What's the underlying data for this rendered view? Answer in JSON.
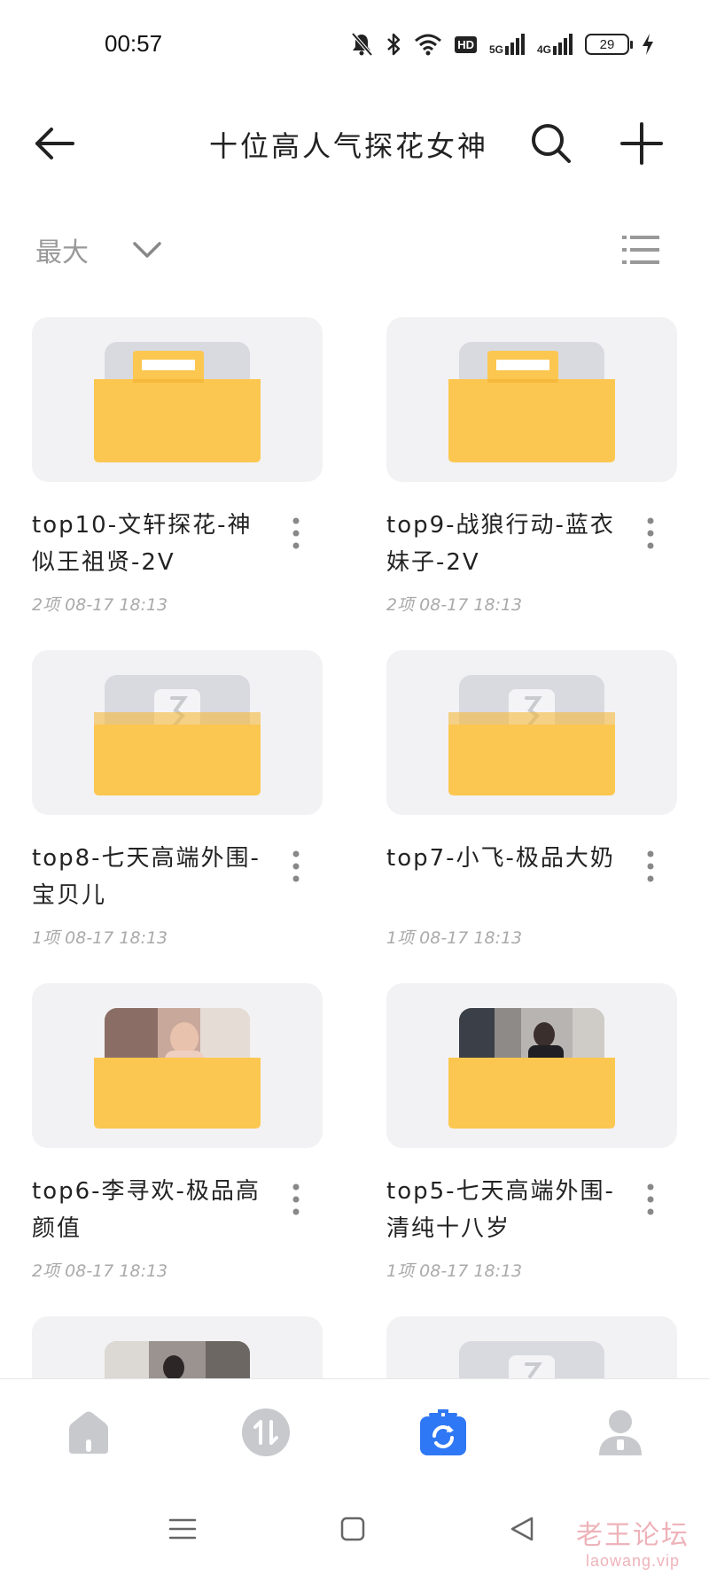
{
  "status_bar": {
    "time": "00:57",
    "icons": [
      "mute-icon",
      "bluetooth-icon",
      "wifi-icon",
      "hd-icon",
      "signal-5g-icon",
      "signal-4g-icon"
    ],
    "hd_label": "HD",
    "net1_label": "5G",
    "net2_label": "4G",
    "battery": "29"
  },
  "header": {
    "title": "十位高人气探花女神",
    "back_icon": "arrow-left-icon",
    "search_icon": "search-icon",
    "add_icon": "plus-icon"
  },
  "sort": {
    "label": "最大",
    "chevron_icon": "chevron-down-icon",
    "view_icon": "list-view-icon"
  },
  "folders": [
    {
      "title": "top10-文轩探花-神似王祖贤-2V",
      "count": "2项",
      "date": "08-17 18:13",
      "thumb": "empty-folder"
    },
    {
      "title": "top9-战狼行动-蓝衣妹子-2V",
      "count": "2项",
      "date": "08-17 18:13",
      "thumb": "empty-folder"
    },
    {
      "title": "top8-七天高端外围-宝贝儿",
      "count": "1项",
      "date": "08-17 18:13",
      "thumb": "app-folder"
    },
    {
      "title": "top7-小飞-极品大奶",
      "count": "1项",
      "date": "08-17 18:13",
      "thumb": "app-folder"
    },
    {
      "title": "top6-李寻欢-极品高颜值",
      "count": "2项",
      "date": "08-17 18:13",
      "thumb": "photo-folder"
    },
    {
      "title": "top5-七天高端外围-清纯十八岁",
      "count": "1项",
      "date": "08-17 18:13",
      "thumb": "photo-folder"
    }
  ],
  "bottom_nav": [
    {
      "name": "home",
      "icon": "home-icon",
      "active": false
    },
    {
      "name": "transfer",
      "icon": "transfer-icon",
      "active": false
    },
    {
      "name": "files",
      "icon": "cloud-files-icon",
      "active": true
    },
    {
      "name": "profile",
      "icon": "user-icon",
      "active": false
    }
  ],
  "colors": {
    "folder_yellow": "#fcc750",
    "folder_back": "#d9dadf",
    "accent_blue": "#2f78f5",
    "card_bg": "#f2f2f4"
  },
  "watermark": {
    "main": "老王论坛",
    "sub": "laowang.vip"
  }
}
